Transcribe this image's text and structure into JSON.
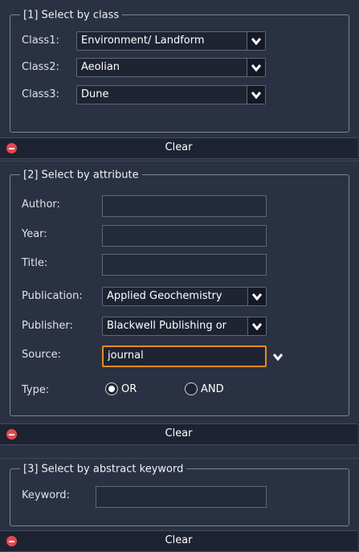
{
  "class_section": {
    "title": "[1] Select by class",
    "fields": [
      {
        "label": "Class1:",
        "value": "Environment/ Landform"
      },
      {
        "label": "Class2:",
        "value": "Aeolian"
      },
      {
        "label": "Class3:",
        "value": "Dune"
      }
    ],
    "clear_label": "Clear"
  },
  "attribute_section": {
    "title": "[2] Select by attribute",
    "author_label": "Author:",
    "author_value": "",
    "year_label": "Year:",
    "year_value": "",
    "title_label": "Title:",
    "title_value": "",
    "publication_label": "Publication:",
    "publication_value": "Applied Geochemistry",
    "publisher_label": "Publisher:",
    "publisher_value": "Blackwell Publishing or",
    "source_label": "Source:",
    "source_value": "journal",
    "type_label": "Type:",
    "type_options": [
      "OR",
      "AND"
    ],
    "type_selected": "OR",
    "clear_label": "Clear"
  },
  "keyword_section": {
    "title": "[3] Select by abstract keyword",
    "keyword_label": "Keyword:",
    "keyword_value": "",
    "clear_label": "Clear"
  },
  "icons": {
    "dropdown": "chevron-down-icon",
    "clear": "minus-circle-icon"
  },
  "colors": {
    "background": "#2a3142",
    "focus_border": "#e88a1c",
    "clear_icon": "#e5484d"
  }
}
